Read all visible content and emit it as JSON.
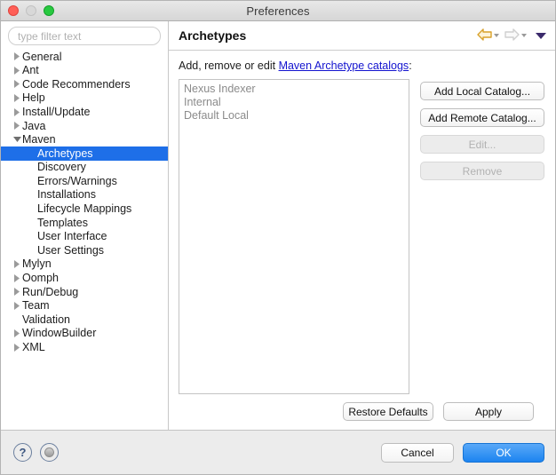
{
  "window": {
    "title": "Preferences",
    "traffic_lights": [
      "close-button",
      "minimize-button",
      "maximize-button"
    ]
  },
  "sidebar": {
    "filter": {
      "value": "",
      "placeholder": "type filter text"
    },
    "items": [
      {
        "label": "General",
        "level": 0,
        "state": "collapsed"
      },
      {
        "label": "Ant",
        "level": 0,
        "state": "collapsed"
      },
      {
        "label": "Code Recommenders",
        "level": 0,
        "state": "collapsed"
      },
      {
        "label": "Help",
        "level": 0,
        "state": "collapsed"
      },
      {
        "label": "Install/Update",
        "level": 0,
        "state": "collapsed"
      },
      {
        "label": "Java",
        "level": 0,
        "state": "collapsed"
      },
      {
        "label": "Maven",
        "level": 0,
        "state": "expanded"
      },
      {
        "label": "Archetypes",
        "level": 1,
        "state": "leaf",
        "selected": true
      },
      {
        "label": "Discovery",
        "level": 1,
        "state": "leaf"
      },
      {
        "label": "Errors/Warnings",
        "level": 1,
        "state": "leaf"
      },
      {
        "label": "Installations",
        "level": 1,
        "state": "leaf"
      },
      {
        "label": "Lifecycle Mappings",
        "level": 1,
        "state": "leaf"
      },
      {
        "label": "Templates",
        "level": 1,
        "state": "leaf"
      },
      {
        "label": "User Interface",
        "level": 1,
        "state": "leaf"
      },
      {
        "label": "User Settings",
        "level": 1,
        "state": "leaf"
      },
      {
        "label": "Mylyn",
        "level": 0,
        "state": "collapsed"
      },
      {
        "label": "Oomph",
        "level": 0,
        "state": "collapsed"
      },
      {
        "label": "Run/Debug",
        "level": 0,
        "state": "collapsed"
      },
      {
        "label": "Team",
        "level": 0,
        "state": "collapsed"
      },
      {
        "label": "Validation",
        "level": 0,
        "state": "leaf"
      },
      {
        "label": "WindowBuilder",
        "level": 0,
        "state": "collapsed"
      },
      {
        "label": "XML",
        "level": 0,
        "state": "collapsed"
      }
    ]
  },
  "pane": {
    "title": "Archetypes",
    "nav": {
      "back_icon": "back-arrow-icon",
      "back_menu_icon": "chevron-down-icon",
      "forward_icon": "forward-arrow-icon",
      "forward_menu_icon": "chevron-down-icon",
      "menu_icon": "view-menu-icon",
      "back_color": "#d8a12a",
      "forward_color": "#cfcfcf",
      "menu_color": "#3b2a6b"
    },
    "intro": {
      "prefix": "Add, remove or edit ",
      "link": "Maven Archetype catalogs",
      "suffix": ":"
    },
    "catalogs": [
      "Nexus Indexer",
      "Internal",
      "Default Local"
    ],
    "side_buttons": [
      {
        "label": "Add Local Catalog...",
        "enabled": true
      },
      {
        "label": "Add Remote Catalog...",
        "enabled": true
      },
      {
        "label": "Edit...",
        "enabled": false
      },
      {
        "label": "Remove",
        "enabled": false
      }
    ],
    "footer_buttons": [
      {
        "label": "Restore Defaults",
        "enabled": true
      },
      {
        "label": "Apply",
        "enabled": true
      }
    ]
  },
  "bottom_bar": {
    "help_icon": "question-mark-icon",
    "help_glyph": "?",
    "secondary_icon": "record-circle-icon",
    "cancel_label": "Cancel",
    "ok_label": "OK",
    "ok_accent": "#1c84f0"
  }
}
